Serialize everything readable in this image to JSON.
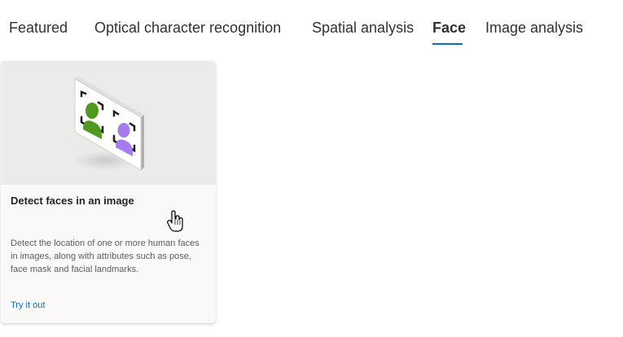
{
  "tabs": [
    {
      "label": "Featured",
      "active": false
    },
    {
      "label": "Optical character recognition",
      "active": false
    },
    {
      "label": "Spatial analysis",
      "active": false
    },
    {
      "label": "Face",
      "active": true
    },
    {
      "label": "Image analysis",
      "active": false
    }
  ],
  "card": {
    "image_icon": "face-detection-illustration",
    "title": "Detect faces in an image",
    "description": "Detect the location of one or more human faces in images, along with attributes such as pose, face mask and facial landmarks.",
    "link_label": "Try it out"
  },
  "colors": {
    "accent": "#0f6cbd",
    "green_face": "#4f9a1e",
    "purple_face": "#a77bf0"
  }
}
